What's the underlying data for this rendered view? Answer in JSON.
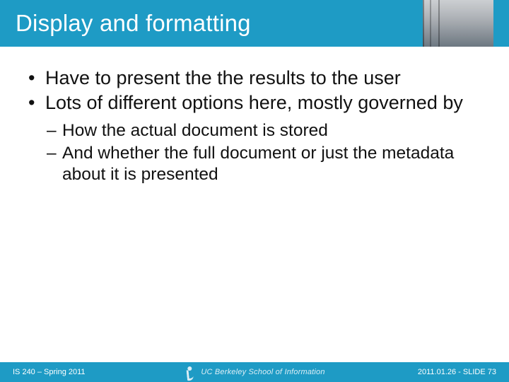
{
  "header": {
    "title": "Display and formatting"
  },
  "content": {
    "bullets": [
      "Have to present the the results to the user",
      "Lots of different options here, mostly governed by"
    ],
    "sub_bullets": [
      "How the actual document is stored",
      "And whether the full document or just the metadata about it is presented"
    ]
  },
  "footer": {
    "left": "IS 240 – Spring 2011",
    "center": "UC Berkeley School of Information",
    "right": "2011.01.26 - SLIDE 73"
  }
}
